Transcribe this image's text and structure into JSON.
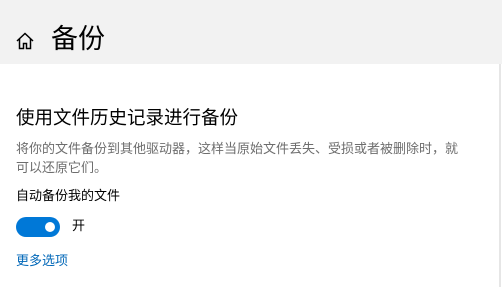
{
  "header": {
    "icon": "home-icon",
    "title": "备份"
  },
  "section": {
    "title": "使用文件历史记录进行备份",
    "description": "将你的文件备份到其他驱动器，这样当原始文件丢失、受损或者被删除时，就可以还原它们。"
  },
  "auto_backup": {
    "label": "自动备份我的文件",
    "state_label": "开",
    "on": true
  },
  "more_options_label": "更多选项",
  "colors": {
    "accent": "#0078d7",
    "link": "#0067b8",
    "header_bg": "#f2f2f2",
    "secondary_text": "#6d6d6d"
  }
}
